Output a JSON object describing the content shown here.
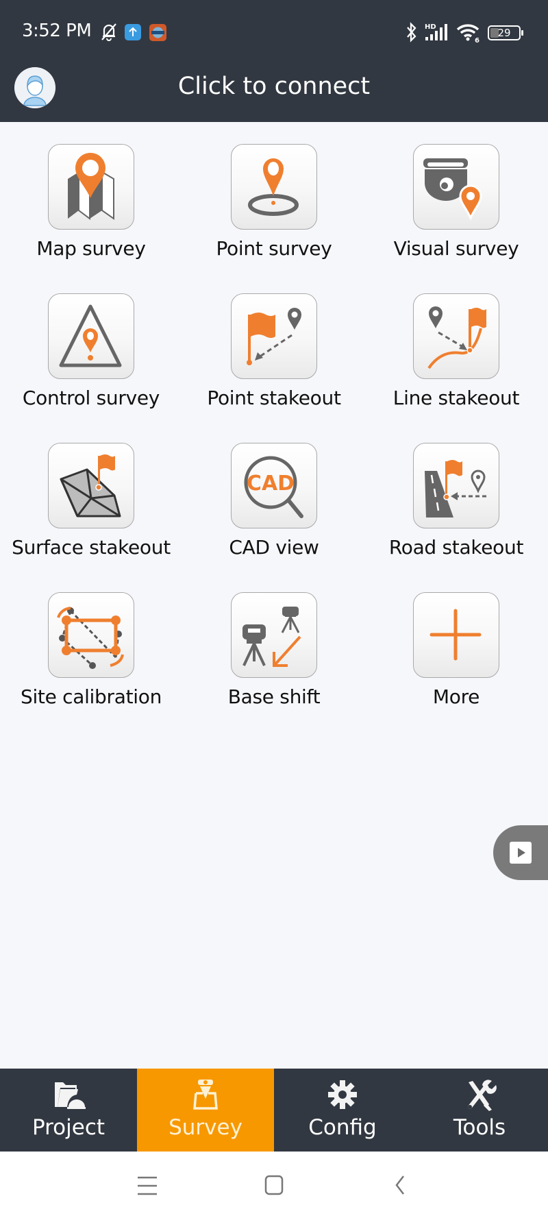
{
  "status_bar": {
    "time": "3:52 PM",
    "left_icons": [
      "notifications-muted-icon",
      "upload-app-icon",
      "chcnav-app-icon"
    ],
    "right_icons": [
      "bluetooth-icon",
      "hd-signal-icon",
      "wifi-6-icon",
      "battery-icon"
    ],
    "battery_level": "29"
  },
  "header": {
    "avatar_icon": "user-avatar-icon",
    "title": "Click to connect"
  },
  "grid": {
    "items": [
      {
        "label": "Map survey",
        "icon": "map-pin-icon"
      },
      {
        "label": "Point survey",
        "icon": "point-pin-icon"
      },
      {
        "label": "Visual survey",
        "icon": "camera-pin-icon"
      },
      {
        "label": "Control survey",
        "icon": "triangle-pin-icon"
      },
      {
        "label": "Point stakeout",
        "icon": "flag-point-icon"
      },
      {
        "label": "Line stakeout",
        "icon": "flag-line-icon"
      },
      {
        "label": "Surface stakeout",
        "icon": "surface-flag-icon"
      },
      {
        "label": "CAD view",
        "icon": "cad-magnifier-icon"
      },
      {
        "label": "Road stakeout",
        "icon": "road-flag-icon"
      },
      {
        "label": "Site calibration",
        "icon": "calibration-icon"
      },
      {
        "label": "Base shift",
        "icon": "base-shift-icon"
      },
      {
        "label": "More",
        "icon": "plus-icon"
      }
    ]
  },
  "floating_button": {
    "icon": "play-icon"
  },
  "bottom_nav": {
    "items": [
      {
        "label": "Project",
        "icon": "folder-icon",
        "active": false
      },
      {
        "label": "Survey",
        "icon": "survey-icon",
        "active": true
      },
      {
        "label": "Config",
        "icon": "gear-icon",
        "active": false
      },
      {
        "label": "Tools",
        "icon": "tools-icon",
        "active": false
      }
    ]
  },
  "system_nav": {
    "buttons": [
      "menu-icon",
      "home-icon",
      "back-icon"
    ]
  },
  "colors": {
    "accent_orange": "#ef7f2f",
    "nav_active": "#f79800",
    "dark_bar": "#323841",
    "icon_gray": "#666666"
  }
}
